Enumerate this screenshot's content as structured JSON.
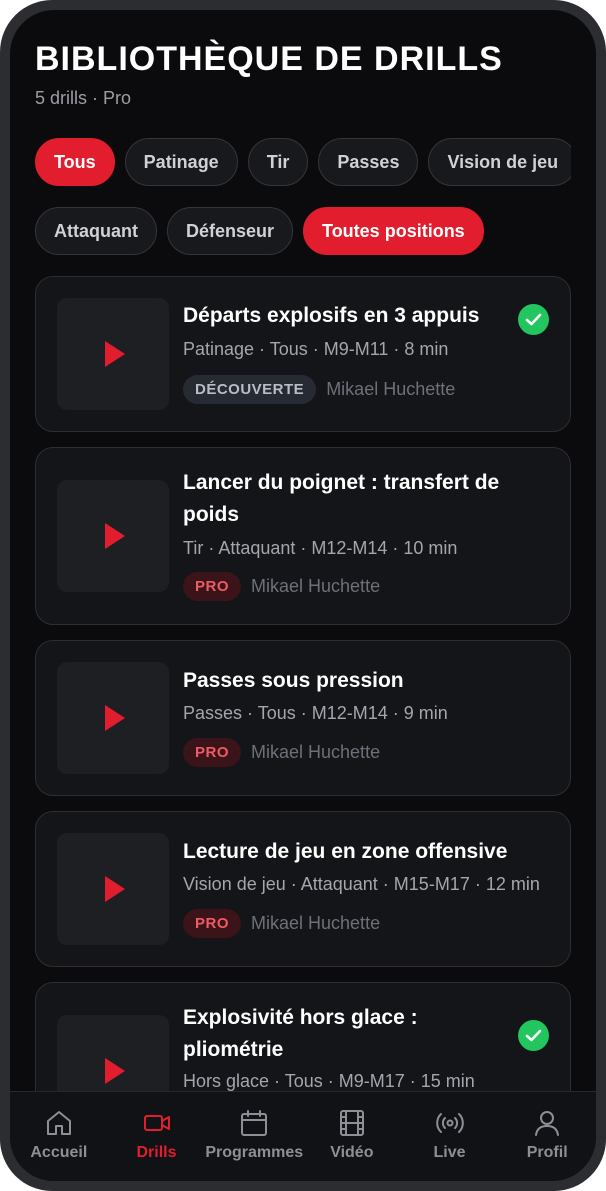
{
  "header": {
    "title": "BIBLIOTHÈQUE DE DRILLS",
    "subtitle": "5 drills · Pro"
  },
  "filters": {
    "categories": [
      "Tous",
      "Patinage",
      "Tir",
      "Passes",
      "Vision de jeu"
    ],
    "active_category": "Tous",
    "positions": [
      "Attaquant",
      "Défenseur",
      "Toutes positions"
    ],
    "active_position": "Toutes positions"
  },
  "drills": [
    {
      "title": "Départs explosifs en 3 appuis",
      "meta": "Patinage · Tous · M9-M11 · 8 min",
      "badge": "DÉCOUVERTE",
      "author": "Mikael Huchette",
      "completed": true
    },
    {
      "title": "Lancer du poignet : transfert de poids",
      "meta": "Tir · Attaquant · M12-M14 · 10 min",
      "badge": "PRO",
      "author": "Mikael Huchette",
      "completed": false
    },
    {
      "title": "Passes sous pression",
      "meta": "Passes · Tous · M12-M14 · 9 min",
      "badge": "PRO",
      "author": "Mikael Huchette",
      "completed": false
    },
    {
      "title": "Lecture de jeu en zone offensive",
      "meta": "Vision de jeu · Attaquant · M15-M17 · 12 min",
      "badge": "PRO",
      "author": "Mikael Huchette",
      "completed": false
    },
    {
      "title": "Explosivité hors glace : pliométrie",
      "meta": "Hors glace · Tous · M9-M17 · 15 min",
      "badge": "",
      "author": "",
      "completed": true
    }
  ],
  "tabbar": {
    "active": "Drills",
    "items": [
      {
        "label": "Accueil",
        "icon": "home-icon"
      },
      {
        "label": "Drills",
        "icon": "video-camera-icon"
      },
      {
        "label": "Programmes",
        "icon": "calendar-icon"
      },
      {
        "label": "Vidéo",
        "icon": "film-icon"
      },
      {
        "label": "Live",
        "icon": "broadcast-icon"
      },
      {
        "label": "Profil",
        "icon": "user-icon"
      }
    ]
  },
  "colors": {
    "accent": "#e11d2e",
    "completed": "#22c55e",
    "background": "#0b0b0d"
  }
}
